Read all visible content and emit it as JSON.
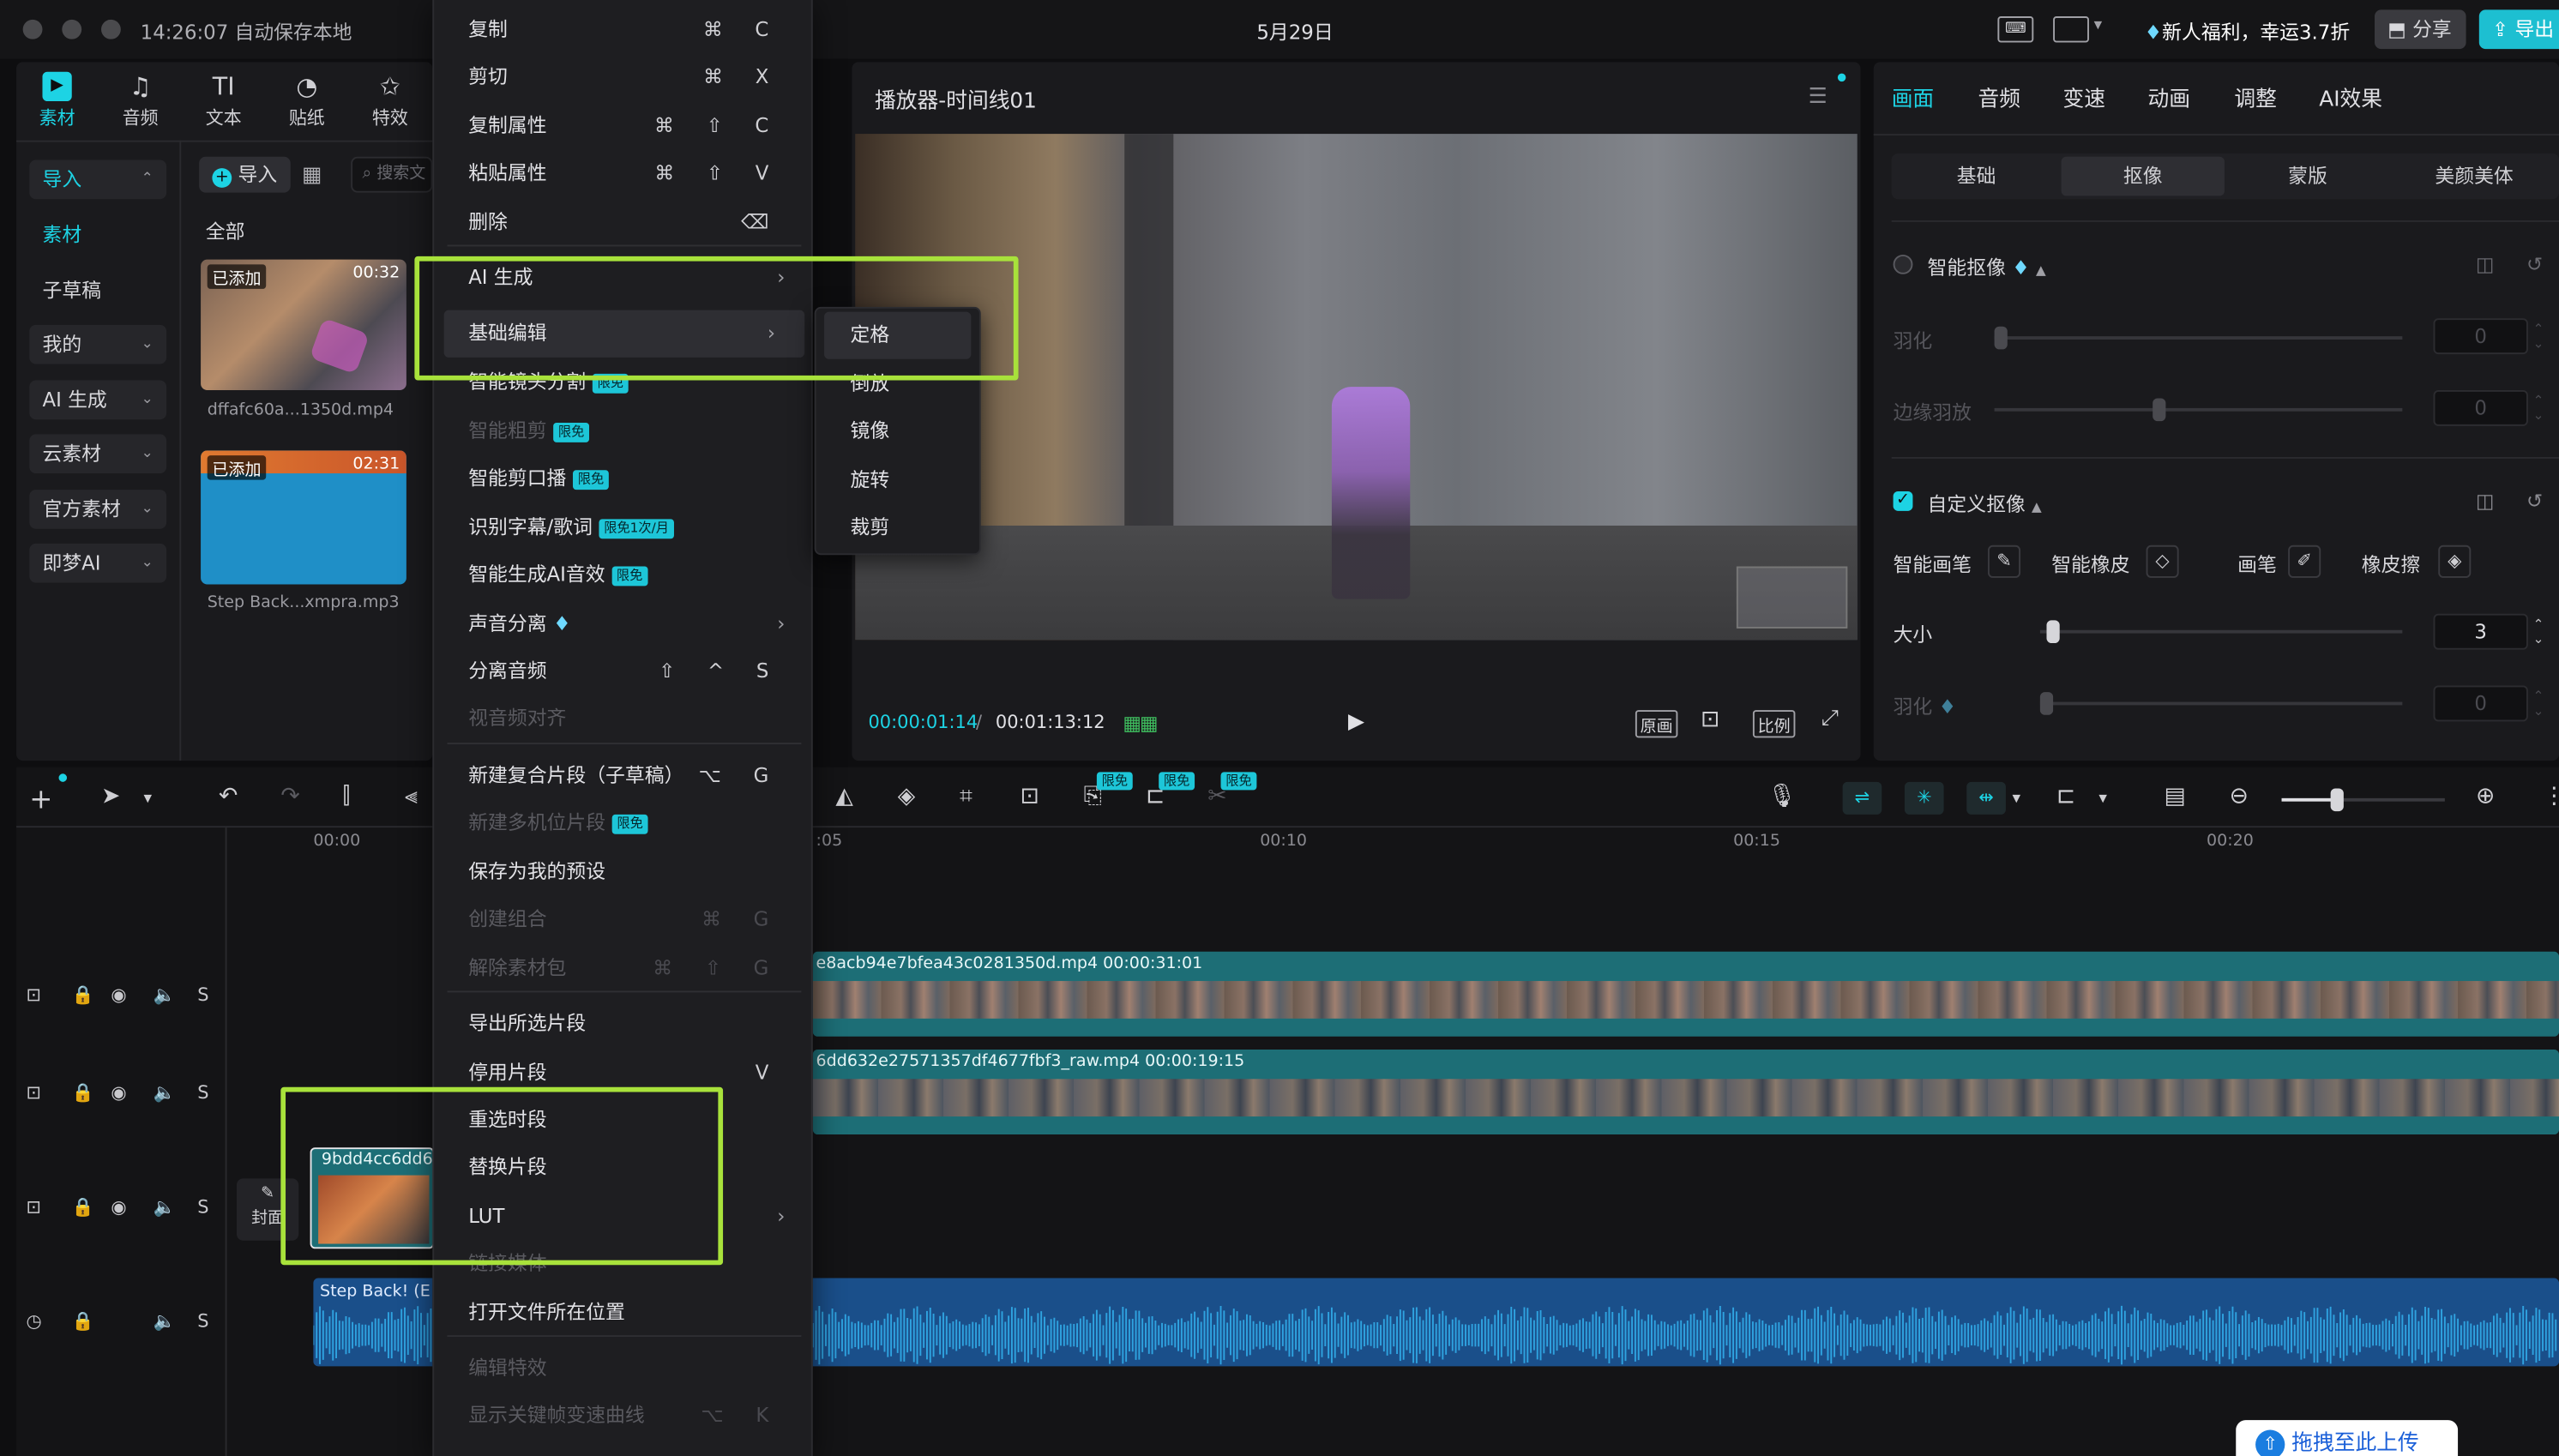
{
  "topbar": {
    "time_status": "14:26:07 自动保存本地",
    "date": "5月29日",
    "promo": "新人福利，幸运3.7折",
    "share": "分享",
    "export": "导出"
  },
  "left_tools": [
    {
      "label": "素材",
      "icon": "media-icon"
    },
    {
      "label": "音频",
      "icon": "audio-icon"
    },
    {
      "label": "文本",
      "icon": "text-icon"
    },
    {
      "label": "贴纸",
      "icon": "sticker-icon"
    },
    {
      "label": "特效",
      "icon": "effects-icon"
    }
  ],
  "sidebar": {
    "items": [
      {
        "label": "导入"
      },
      {
        "label": "素材"
      },
      {
        "label": "子草稿"
      },
      {
        "label": "我的"
      },
      {
        "label": "AI 生成"
      },
      {
        "label": "云素材"
      },
      {
        "label": "官方素材"
      },
      {
        "label": "即梦AI"
      }
    ]
  },
  "media": {
    "import_button": "导入",
    "search_placeholder": "搜索文",
    "filter_all": "全部",
    "items": [
      {
        "badge": "已添加",
        "duration": "00:32",
        "name": "dffafc60a...1350d.mp4"
      },
      {
        "badge": "已添加",
        "duration": "02:31",
        "name": "Step Back...xmpra.mp3"
      }
    ]
  },
  "context_menu": {
    "items": [
      {
        "label": "复制",
        "shortcut": "⌘ C"
      },
      {
        "label": "剪切",
        "shortcut": "⌘ X"
      },
      {
        "label": "复制属性",
        "shortcut": "⌘ ⇧ C"
      },
      {
        "label": "粘贴属性",
        "shortcut": "⌘ ⇧ V"
      },
      {
        "label": "删除",
        "shortcut": "⌫"
      },
      {
        "label": "AI 生成"
      },
      {
        "label": "基础编辑"
      },
      {
        "label": "智能镜头分割",
        "badge": "限免"
      },
      {
        "label": "智能粗剪",
        "badge": "限免"
      },
      {
        "label": "智能剪口播",
        "badge": "限免"
      },
      {
        "label": "识别字幕/歌词",
        "badge": "限免1次/月"
      },
      {
        "label": "智能生成AI音效",
        "badge": "限免"
      },
      {
        "label": "声音分离"
      },
      {
        "label": "分离音频",
        "shortcut": "⇧ ^ S"
      },
      {
        "label": "视音频对齐"
      },
      {
        "label": "新建复合片段（子草稿）",
        "shortcut": "⌥ G"
      },
      {
        "label": "新建多机位片段",
        "badge": "限免"
      },
      {
        "label": "保存为我的预设"
      },
      {
        "label": "创建组合",
        "shortcut": "⌘ G"
      },
      {
        "label": "解除素材包",
        "shortcut": "⌘ ⇧ G"
      },
      {
        "label": "导出所选片段"
      },
      {
        "label": "停用片段",
        "shortcut": "V"
      },
      {
        "label": "重选时段"
      },
      {
        "label": "替换片段"
      },
      {
        "label": "LUT"
      },
      {
        "label": "链接媒体"
      },
      {
        "label": "打开文件所在位置"
      },
      {
        "label": "编辑特效"
      },
      {
        "label": "显示关键帧变速曲线",
        "shortcut": "⌥ K"
      }
    ]
  },
  "submenu": {
    "items": [
      {
        "label": "定格"
      },
      {
        "label": "倒放"
      },
      {
        "label": "镜像"
      },
      {
        "label": "旋转"
      },
      {
        "label": "裁剪"
      }
    ]
  },
  "player": {
    "title": "播放器-时间线01",
    "current": "00:00:01:14",
    "total": "00:01:13:12",
    "btn_original": "原画",
    "btn_ratio": "比例"
  },
  "right_panel": {
    "tabs": [
      "画面",
      "音频",
      "变速",
      "动画",
      "调整",
      "AI效果"
    ],
    "segments": [
      "基础",
      "抠像",
      "蒙版",
      "美颜美体"
    ],
    "smart_cutout": {
      "label": "智能抠像",
      "feather": "羽化",
      "feather_val": "0",
      "edge": "边缘羽放",
      "edge_val": "0",
      "feather_level": 0,
      "edge_level": 0.4
    },
    "custom_cutout": {
      "label": "自定义抠像",
      "brush_smart": "智能画笔",
      "eraser_smart": "智能橡皮",
      "brush": "画笔",
      "eraser": "橡皮擦",
      "size": "大小",
      "size_val": "3",
      "size_level": 0.02,
      "feather": "羽化",
      "feather_val": "0",
      "feather_level": 0
    }
  },
  "timeline": {
    "ticks": [
      "00:00",
      ":05",
      "00:10",
      "00:15",
      "00:20"
    ],
    "clip1": "e8acb94e7bfea43c0281350d.mp4  00:00:31:01",
    "clip2": "6dd632e27571357df4677fbf3_raw.mp4  00:00:19:15",
    "clip3": "9bdd4cc6dd6",
    "audio": "Step Back! (E",
    "cover": "封面",
    "zoom_level": 0.33,
    "upload": "拖拽至此上传"
  },
  "colors": {
    "accent": "#1dd3e4",
    "highlight": "#a8e23b"
  }
}
